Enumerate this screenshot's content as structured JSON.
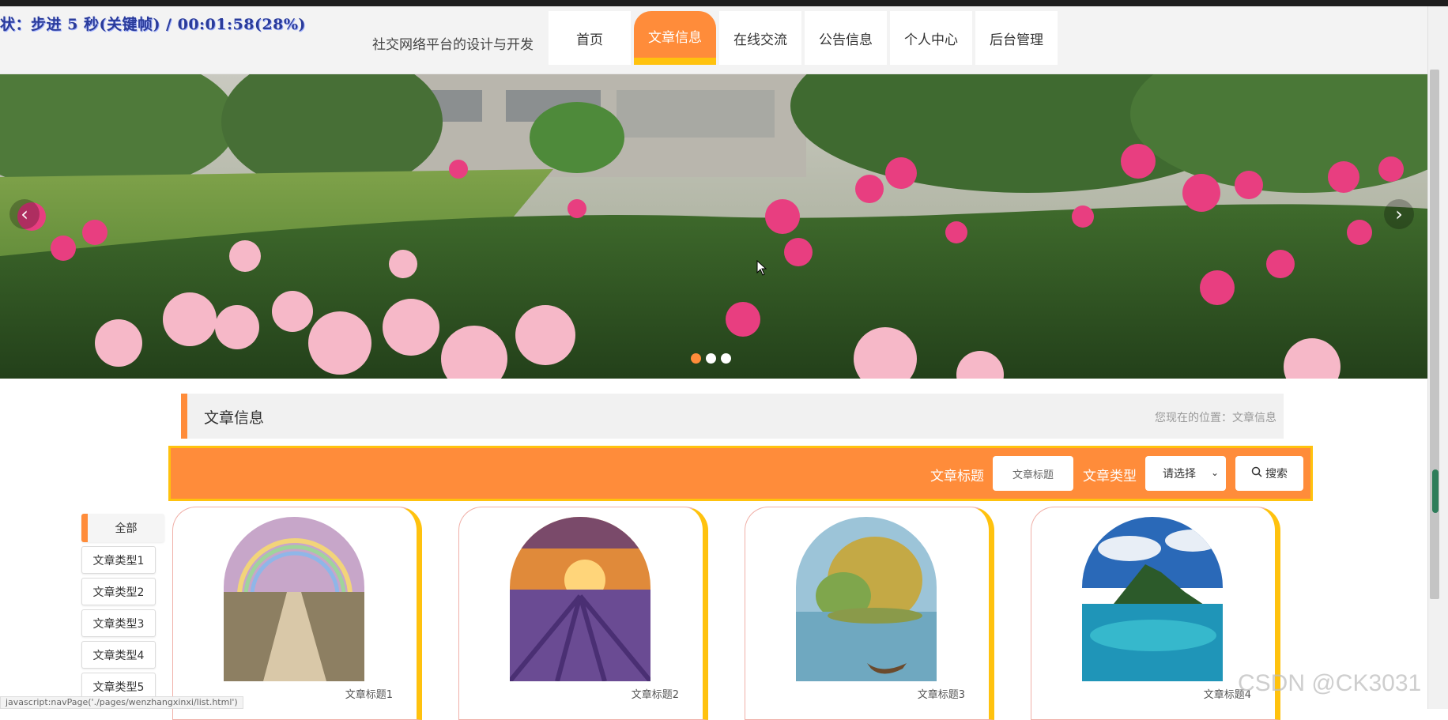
{
  "overlay": {
    "text": "状：步进 5 秒(关键帧) / 00:01:58(28%)"
  },
  "header": {
    "site_title": "社交网络平台的设计与开发"
  },
  "nav": [
    {
      "label": "首页"
    },
    {
      "label": "文章信息",
      "active": true
    },
    {
      "label": "在线交流"
    },
    {
      "label": "公告信息"
    },
    {
      "label": "个人中心"
    },
    {
      "label": "后台管理"
    }
  ],
  "banner": {
    "prev_icon": "chevron-left-icon",
    "next_icon": "chevron-right-icon",
    "dots": 3,
    "active_dot": 0
  },
  "section": {
    "title": "文章信息",
    "location": "您现在的位置：文章信息"
  },
  "search": {
    "title_label": "文章标题",
    "title_placeholder": "文章标题",
    "type_label": "文章类型",
    "type_selected": "请选择",
    "button_label": "搜索",
    "button_icon": "search-icon"
  },
  "categories": [
    "全部",
    "文章类型1",
    "文章类型2",
    "文章类型3",
    "文章类型4",
    "文章类型5"
  ],
  "cards": [
    {
      "title": "文章标题1"
    },
    {
      "title": "文章标题2"
    },
    {
      "title": "文章标题3"
    },
    {
      "title": "文章标题4"
    }
  ],
  "status_url": "javascript:navPage('./pages/wenzhangxinxi/list.html')",
  "watermark": "CSDN @CK3031",
  "colors": {
    "accent": "#ff8c3a",
    "highlight": "#ffc20e"
  }
}
